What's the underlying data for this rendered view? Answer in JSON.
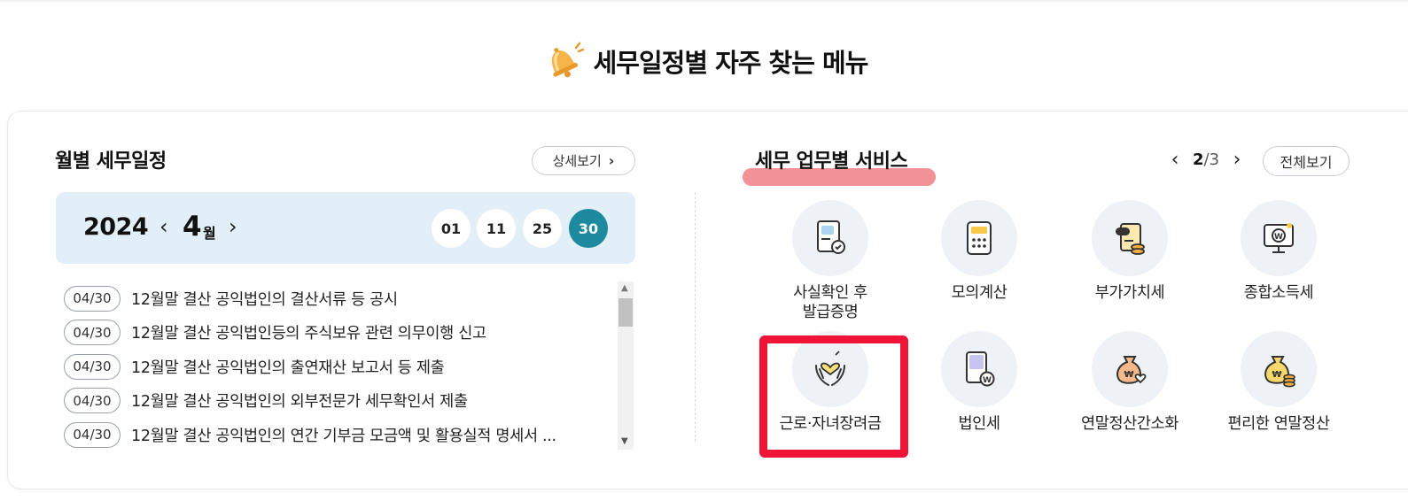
{
  "heading": {
    "title": "세무일정별 자주 찾는 메뉴",
    "icon": "bell-icon"
  },
  "monthly": {
    "title": "월별 세무일정",
    "more_label": "상세보기",
    "year": "2024",
    "month": "4",
    "month_unit": "월",
    "days": [
      "01",
      "11",
      "25",
      "30"
    ],
    "active_day": "30",
    "items": [
      {
        "date": "04/30",
        "text": "12월말 결산 공익법인의 결산서류 등 공시"
      },
      {
        "date": "04/30",
        "text": "12월말 결산 공익법인등의 주식보유 관련 의무이행 신고"
      },
      {
        "date": "04/30",
        "text": "12월말 결산 공익법인의 출연재산 보고서 등 제출"
      },
      {
        "date": "04/30",
        "text": "12월말 결산 공익법인의 외부전문가 세무확인서 제출"
      },
      {
        "date": "04/30",
        "text": "12월말 결산 공익법인의 연간 기부금 모금액 및 활용실적 명세서 ..."
      }
    ]
  },
  "services": {
    "title": "세무 업무별 서비스",
    "page_current": "2",
    "page_sep": "/",
    "page_total": "3",
    "all_label": "전체보기",
    "accent_color": "#f28b93",
    "highlight_box_color": "#ef1437",
    "items": [
      {
        "label": "사실확인 후\n발급증명",
        "icon": "document-certificate-icon"
      },
      {
        "label": "모의계산",
        "icon": "calculator-icon"
      },
      {
        "label": "부가가치세",
        "icon": "vat-coins-icon"
      },
      {
        "label": "종합소득세",
        "icon": "monitor-won-icon"
      },
      {
        "label": "근로·자녀장려금",
        "icon": "hands-heart-icon"
      },
      {
        "label": "법인세",
        "icon": "building-won-icon"
      },
      {
        "label": "연말정산간소화",
        "icon": "money-bag-heart-icon"
      },
      {
        "label": "편리한 연말정산",
        "icon": "money-bag-coins-icon"
      }
    ]
  }
}
